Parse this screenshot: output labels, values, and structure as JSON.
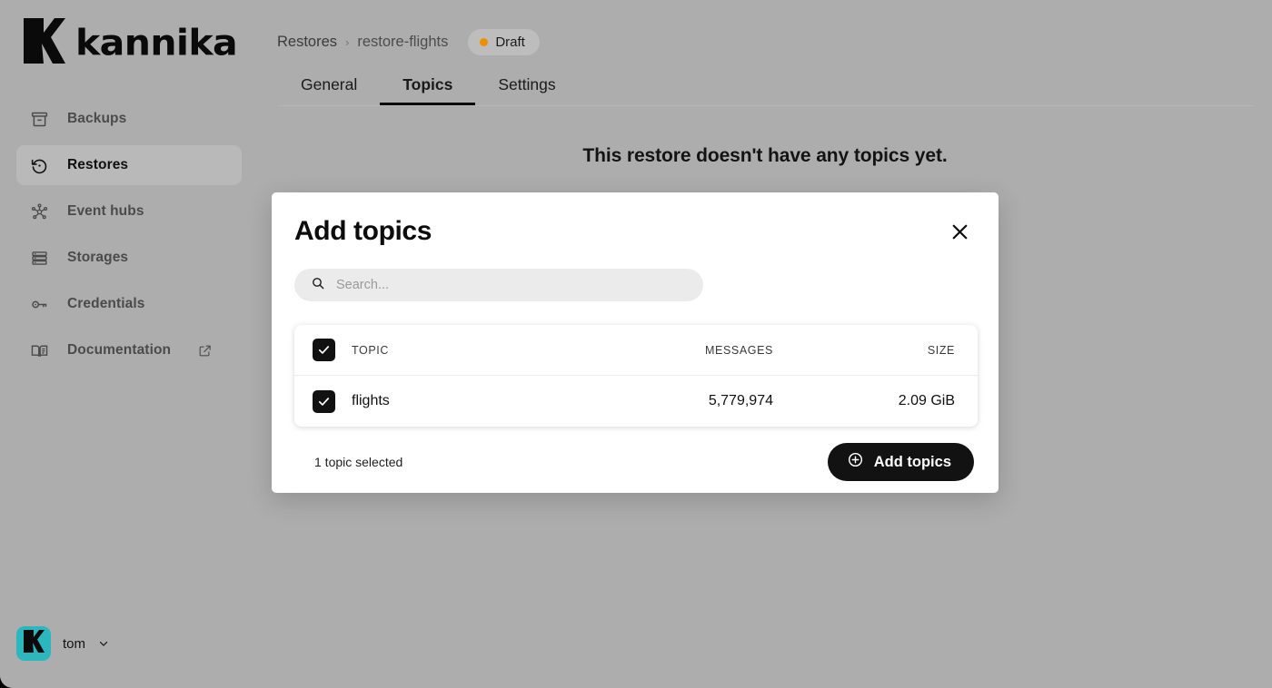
{
  "brand": {
    "name": "kannika",
    "logo_icon": "kannika-k-logo",
    "accent_color": "#2bb7bd"
  },
  "sidebar": {
    "items": [
      {
        "label": "Backups",
        "icon": "archive-box-icon",
        "active": false,
        "external": false
      },
      {
        "label": "Restores",
        "icon": "restore-history-icon",
        "active": true,
        "external": false
      },
      {
        "label": "Event hubs",
        "icon": "network-hub-icon",
        "active": false,
        "external": false
      },
      {
        "label": "Storages",
        "icon": "server-stack-icon",
        "active": false,
        "external": false
      },
      {
        "label": "Credentials",
        "icon": "key-icon",
        "active": false,
        "external": false
      },
      {
        "label": "Documentation",
        "icon": "book-icon",
        "active": false,
        "external": true,
        "external_icon": "external-link-icon"
      }
    ],
    "user": {
      "name": "tom",
      "avatar_icon": "kannika-k-avatar",
      "chevron_icon": "chevron-down-icon"
    }
  },
  "header": {
    "breadcrumb": {
      "root": "Restores",
      "separator": "›",
      "current": "restore-flights"
    },
    "status_badge": {
      "label": "Draft",
      "dot_color": "#ef8f00",
      "dot_icon": "status-dot-icon"
    },
    "tabs": [
      {
        "label": "General",
        "active": false
      },
      {
        "label": "Topics",
        "active": true
      },
      {
        "label": "Settings",
        "active": false
      }
    ]
  },
  "main": {
    "empty_message": "This restore doesn't have any topics yet."
  },
  "modal": {
    "title": "Add topics",
    "close_icon": "close-icon",
    "search": {
      "placeholder": "Search...",
      "value": "",
      "icon": "search-icon"
    },
    "table": {
      "select_all_checked": true,
      "columns": [
        "TOPIC",
        "MESSAGES",
        "SIZE"
      ],
      "rows": [
        {
          "checked": true,
          "topic": "flights",
          "messages": "5,779,974",
          "size": "2.09 GiB"
        }
      ]
    },
    "footer": {
      "selection_text": "1 topic selected",
      "primary_button": {
        "label": "Add topics",
        "icon": "plus-circle-icon"
      }
    }
  }
}
